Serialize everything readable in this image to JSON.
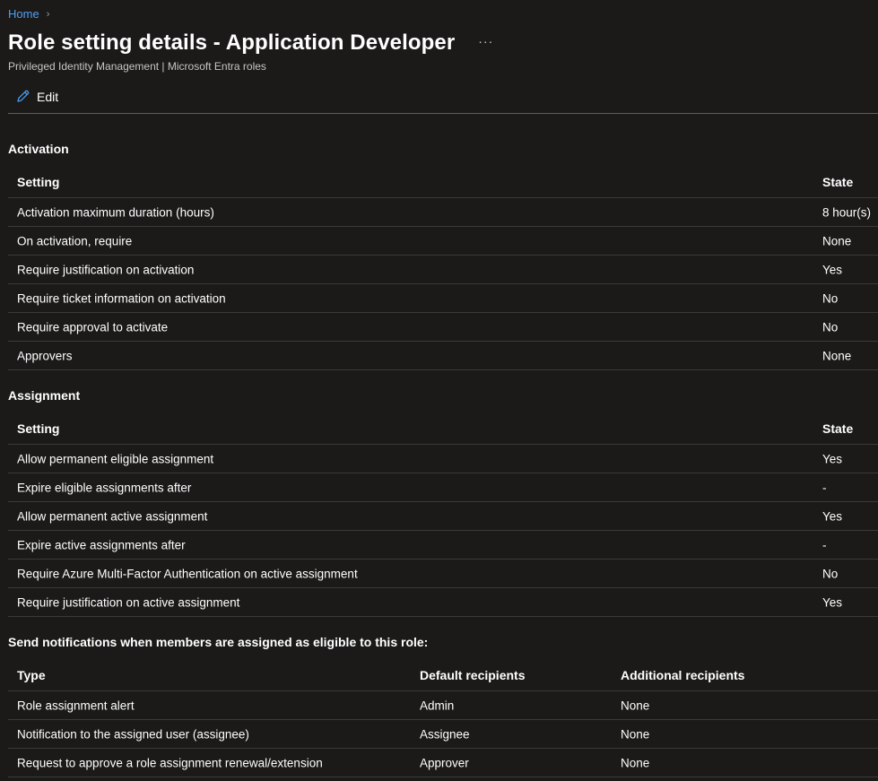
{
  "breadcrumb": {
    "home": "Home",
    "chevron": "›"
  },
  "title": "Role setting details - Application Developer",
  "more_label": "···",
  "subtitle": "Privileged Identity Management | Microsoft Entra roles",
  "toolbar": {
    "edit_label": "Edit",
    "edit_icon": "pencil-icon"
  },
  "activation": {
    "title": "Activation",
    "headers": {
      "setting": "Setting",
      "state": "State"
    },
    "rows": [
      {
        "setting": "Activation maximum duration (hours)",
        "state": "8 hour(s)"
      },
      {
        "setting": "On activation, require",
        "state": "None"
      },
      {
        "setting": "Require justification on activation",
        "state": "Yes"
      },
      {
        "setting": "Require ticket information on activation",
        "state": "No"
      },
      {
        "setting": "Require approval to activate",
        "state": "No"
      },
      {
        "setting": "Approvers",
        "state": "None"
      }
    ]
  },
  "assignment": {
    "title": "Assignment",
    "headers": {
      "setting": "Setting",
      "state": "State"
    },
    "rows": [
      {
        "setting": "Allow permanent eligible assignment",
        "state": "Yes"
      },
      {
        "setting": "Expire eligible assignments after",
        "state": "-"
      },
      {
        "setting": "Allow permanent active assignment",
        "state": "Yes"
      },
      {
        "setting": "Expire active assignments after",
        "state": "-"
      },
      {
        "setting": "Require Azure Multi-Factor Authentication on active assignment",
        "state": "No"
      },
      {
        "setting": "Require justification on active assignment",
        "state": "Yes"
      }
    ]
  },
  "notifications": {
    "title": "Send notifications when members are assigned as eligible to this role:",
    "headers": {
      "type": "Type",
      "default": "Default recipients",
      "additional": "Additional recipients"
    },
    "rows": [
      {
        "type": "Role assignment alert",
        "default": "Admin",
        "additional": "None"
      },
      {
        "type": "Notification to the assigned user (assignee)",
        "default": "Assignee",
        "additional": "None"
      },
      {
        "type": "Request to approve a role assignment renewal/extension",
        "default": "Approver",
        "additional": "None"
      }
    ]
  },
  "colors": {
    "link": "#4ea1f3",
    "background": "#1b1a19",
    "divider": "#3b3a39"
  }
}
